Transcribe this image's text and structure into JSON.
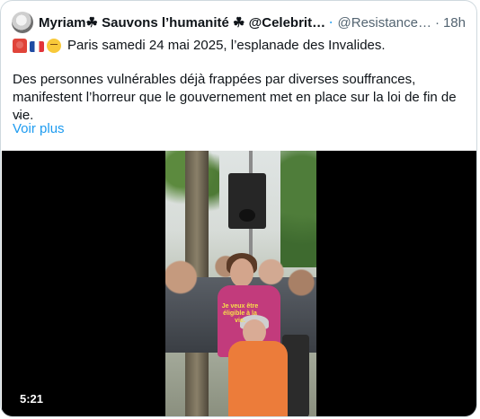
{
  "tweet": {
    "display_name": "Myriam☘ Sauvons l’humanité ☘ @Celebrit…",
    "handle": "@Resistance…",
    "separator": "·",
    "time": "18h",
    "first_line": "Paris samedi 24 mai 2025, l’esplanade des Invalides.",
    "body": "Des personnes vulnérables déjà frappées par diverses souffrances, manifestent l’horreur que le gouvernement met en place sur la loi de fin de vie.",
    "ellipsis": "…",
    "show_more": "Voir plus",
    "emojis": [
      "siren-emoji",
      "french-flag-emoji",
      "relieved-face-emoji"
    ]
  },
  "video": {
    "caption": "Je veux être éligible à la vie.",
    "duration": "5:21"
  },
  "colors": {
    "link": "#1d9bf0",
    "muted": "#536471",
    "verified": "#1d9bf0",
    "caption": "#f7e04a"
  }
}
